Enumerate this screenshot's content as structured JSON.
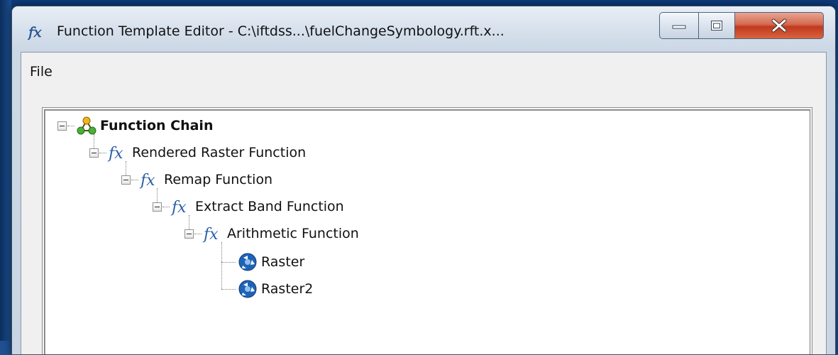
{
  "window": {
    "title": "Function Template Editor - C:\\iftdss...\\fuelChangeSymbology.rft.x...",
    "controls": [
      "minimize",
      "maximize",
      "close"
    ]
  },
  "menu": {
    "file_label": "File"
  },
  "tree": {
    "root": {
      "label": "Function Chain",
      "icon": "function-chain-icon"
    },
    "nodes": [
      {
        "label": "Rendered Raster Function",
        "icon": "function-fx-icon"
      },
      {
        "label": "Remap Function",
        "icon": "function-fx-icon"
      },
      {
        "label": "Extract Band Function",
        "icon": "function-fx-icon"
      },
      {
        "label": "Arithmetic Function",
        "icon": "function-fx-icon"
      }
    ],
    "leaves": [
      {
        "label": "Raster",
        "icon": "raster-variable-icon"
      },
      {
        "label": "Raster2",
        "icon": "raster-variable-icon"
      }
    ]
  },
  "colors": {
    "close_button": "#c2391d",
    "titlebar": "#d6e0ec",
    "fx_icon": "#2b5fa8"
  }
}
